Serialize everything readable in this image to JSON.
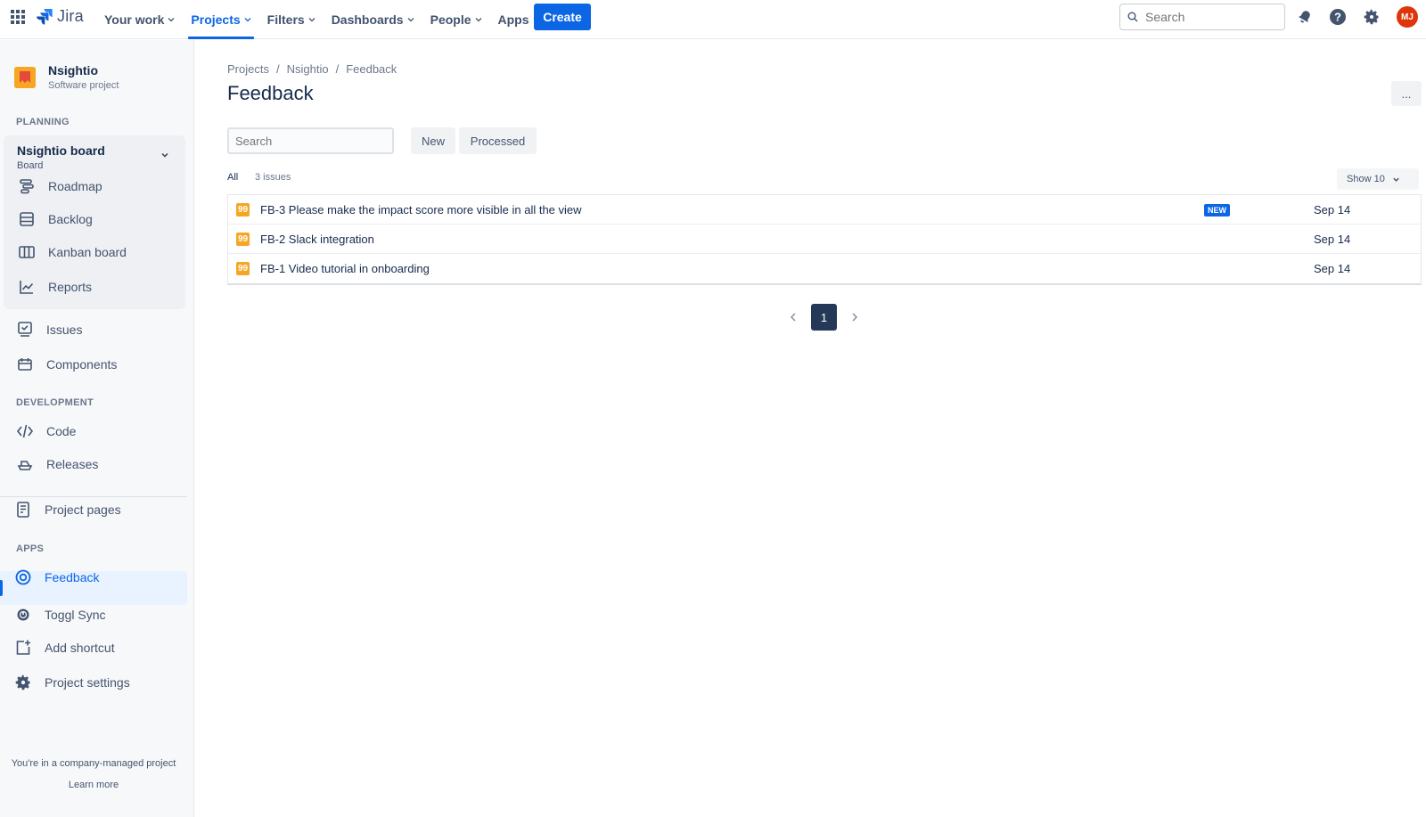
{
  "topnav": {
    "logo": "Jira",
    "items": [
      {
        "label": "Your work"
      },
      {
        "label": "Projects"
      },
      {
        "label": "Filters"
      },
      {
        "label": "Dashboards"
      },
      {
        "label": "People"
      },
      {
        "label": "Apps"
      }
    ],
    "active_item": "Projects",
    "create_label": "Create",
    "search_placeholder": "Search",
    "avatar_initials": "MJ",
    "accent": "#0C66E4"
  },
  "sidebar": {
    "project_name": "Nsightio",
    "project_type": "Software project",
    "planning_heading": "PLANNING",
    "board_title": "Nsightio board",
    "board_subtitle": "Board",
    "planning_items": [
      {
        "label": "Roadmap",
        "icon": "roadmap-icon"
      },
      {
        "label": "Backlog",
        "icon": "backlog-icon"
      },
      {
        "label": "Kanban board",
        "icon": "kanban-icon"
      },
      {
        "label": "Reports",
        "icon": "reports-icon"
      }
    ],
    "other_items": [
      {
        "label": "Issues",
        "icon": "issues-icon"
      },
      {
        "label": "Components",
        "icon": "components-icon"
      }
    ],
    "development_heading": "DEVELOPMENT",
    "development_items": [
      {
        "label": "Code",
        "icon": "code-icon"
      },
      {
        "label": "Releases",
        "icon": "releases-icon"
      }
    ],
    "project_pages_label": "Project pages",
    "apps_heading": "APPS",
    "apps_items": [
      {
        "label": "Feedback",
        "icon": "feedback-icon"
      },
      {
        "label": "Toggl Sync",
        "icon": "toggl-icon"
      },
      {
        "label": "Add shortcut",
        "icon": "add-shortcut-icon"
      },
      {
        "label": "Project settings",
        "icon": "gear-icon"
      }
    ],
    "footer_text": "You're in a company-managed project",
    "learn_more": "Learn more"
  },
  "main": {
    "breadcrumb": [
      "Projects",
      "Nsightio",
      "Feedback"
    ],
    "breadcrumb_sep": "/",
    "title": "Feedback",
    "more_label": "...",
    "search_placeholder": "Search",
    "filters": [
      "New",
      "Processed"
    ],
    "all_label": "All",
    "count_label": "3 issues",
    "show_label": "Show 10",
    "issues": [
      {
        "summary": "FB-3 Please make the impact score more visible in all the view",
        "badge": "NEW",
        "date": "Sep 14"
      },
      {
        "summary": "FB-2 Slack integration",
        "badge": "",
        "date": "Sep 14"
      },
      {
        "summary": "FB-1 Video tutorial in onboarding",
        "badge": "",
        "date": "Sep 14"
      }
    ],
    "issue_icon_glyph": "99",
    "current_page": "1"
  }
}
